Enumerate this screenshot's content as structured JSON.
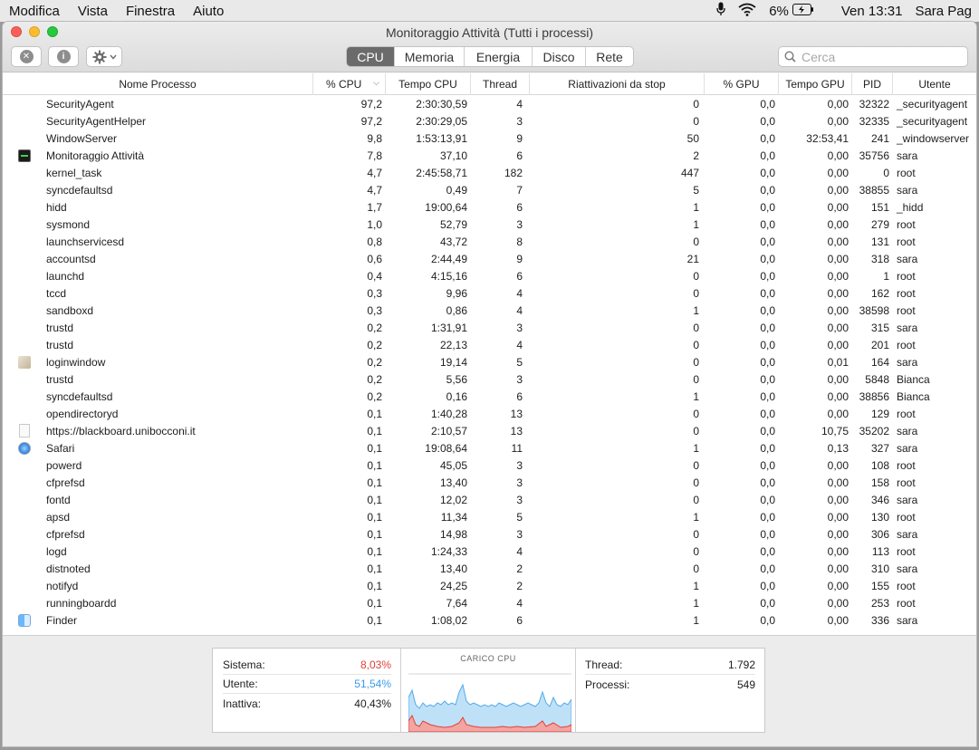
{
  "menubar": {
    "items": [
      "Modifica",
      "Vista",
      "Finestra",
      "Aiuto"
    ],
    "battery": "6%",
    "clock": "Ven 13:31",
    "user": "Sara Pag"
  },
  "window": {
    "title": "Monitoraggio Attività (Tutti i processi)",
    "tabs": [
      {
        "label": "CPU",
        "active": true
      },
      {
        "label": "Memoria",
        "active": false
      },
      {
        "label": "Energia",
        "active": false
      },
      {
        "label": "Disco",
        "active": false
      },
      {
        "label": "Rete",
        "active": false
      }
    ],
    "search_placeholder": "Cerca"
  },
  "table": {
    "columns": [
      "Nome Processo",
      "% CPU",
      "Tempo CPU",
      "Thread",
      "Riattivazioni da stop",
      "% GPU",
      "Tempo GPU",
      "PID",
      "Utente"
    ],
    "rows": [
      {
        "icon": "",
        "name": "SecurityAgent",
        "cpu": "97,2",
        "time": "2:30:30,59",
        "threads": "4",
        "wakeups": "0",
        "gpu": "0,0",
        "gtime": "0,00",
        "pid": "32322",
        "user": "_securityagent"
      },
      {
        "icon": "",
        "name": "SecurityAgentHelper",
        "cpu": "97,2",
        "time": "2:30:29,05",
        "threads": "3",
        "wakeups": "0",
        "gpu": "0,0",
        "gtime": "0,00",
        "pid": "32335",
        "user": "_securityagent"
      },
      {
        "icon": "",
        "name": "WindowServer",
        "cpu": "9,8",
        "time": "1:53:13,91",
        "threads": "9",
        "wakeups": "50",
        "gpu": "0,0",
        "gtime": "32:53,41",
        "pid": "241",
        "user": "_windowserver"
      },
      {
        "icon": "activity-monitor-icon",
        "name": "Monitoraggio Attività",
        "cpu": "7,8",
        "time": "37,10",
        "threads": "6",
        "wakeups": "2",
        "gpu": "0,0",
        "gtime": "0,00",
        "pid": "35756",
        "user": "sara"
      },
      {
        "icon": "",
        "name": "kernel_task",
        "cpu": "4,7",
        "time": "2:45:58,71",
        "threads": "182",
        "wakeups": "447",
        "gpu": "0,0",
        "gtime": "0,00",
        "pid": "0",
        "user": "root"
      },
      {
        "icon": "",
        "name": "syncdefaultsd",
        "cpu": "4,7",
        "time": "0,49",
        "threads": "7",
        "wakeups": "5",
        "gpu": "0,0",
        "gtime": "0,00",
        "pid": "38855",
        "user": "sara"
      },
      {
        "icon": "",
        "name": "hidd",
        "cpu": "1,7",
        "time": "19:00,64",
        "threads": "6",
        "wakeups": "1",
        "gpu": "0,0",
        "gtime": "0,00",
        "pid": "151",
        "user": "_hidd"
      },
      {
        "icon": "",
        "name": "sysmond",
        "cpu": "1,0",
        "time": "52,79",
        "threads": "3",
        "wakeups": "1",
        "gpu": "0,0",
        "gtime": "0,00",
        "pid": "279",
        "user": "root"
      },
      {
        "icon": "",
        "name": "launchservicesd",
        "cpu": "0,8",
        "time": "43,72",
        "threads": "8",
        "wakeups": "0",
        "gpu": "0,0",
        "gtime": "0,00",
        "pid": "131",
        "user": "root"
      },
      {
        "icon": "",
        "name": "accountsd",
        "cpu": "0,6",
        "time": "2:44,49",
        "threads": "9",
        "wakeups": "21",
        "gpu": "0,0",
        "gtime": "0,00",
        "pid": "318",
        "user": "sara"
      },
      {
        "icon": "",
        "name": "launchd",
        "cpu": "0,4",
        "time": "4:15,16",
        "threads": "6",
        "wakeups": "0",
        "gpu": "0,0",
        "gtime": "0,00",
        "pid": "1",
        "user": "root"
      },
      {
        "icon": "",
        "name": "tccd",
        "cpu": "0,3",
        "time": "9,96",
        "threads": "4",
        "wakeups": "0",
        "gpu": "0,0",
        "gtime": "0,00",
        "pid": "162",
        "user": "root"
      },
      {
        "icon": "",
        "name": "sandboxd",
        "cpu": "0,3",
        "time": "0,86",
        "threads": "4",
        "wakeups": "1",
        "gpu": "0,0",
        "gtime": "0,00",
        "pid": "38598",
        "user": "root"
      },
      {
        "icon": "",
        "name": "trustd",
        "cpu": "0,2",
        "time": "1:31,91",
        "threads": "3",
        "wakeups": "0",
        "gpu": "0,0",
        "gtime": "0,00",
        "pid": "315",
        "user": "sara"
      },
      {
        "icon": "",
        "name": "trustd",
        "cpu": "0,2",
        "time": "22,13",
        "threads": "4",
        "wakeups": "0",
        "gpu": "0,0",
        "gtime": "0,00",
        "pid": "201",
        "user": "root"
      },
      {
        "icon": "loginwindow-icon",
        "name": "loginwindow",
        "cpu": "0,2",
        "time": "19,14",
        "threads": "5",
        "wakeups": "0",
        "gpu": "0,0",
        "gtime": "0,01",
        "pid": "164",
        "user": "sara"
      },
      {
        "icon": "",
        "name": "trustd",
        "cpu": "0,2",
        "time": "5,56",
        "threads": "3",
        "wakeups": "0",
        "gpu": "0,0",
        "gtime": "0,00",
        "pid": "5848",
        "user": "Bianca"
      },
      {
        "icon": "",
        "name": "syncdefaultsd",
        "cpu": "0,2",
        "time": "0,16",
        "threads": "6",
        "wakeups": "1",
        "gpu": "0,0",
        "gtime": "0,00",
        "pid": "38856",
        "user": "Bianca"
      },
      {
        "icon": "",
        "name": "opendirectoryd",
        "cpu": "0,1",
        "time": "1:40,28",
        "threads": "13",
        "wakeups": "0",
        "gpu": "0,0",
        "gtime": "0,00",
        "pid": "129",
        "user": "root"
      },
      {
        "icon": "document-icon",
        "name": "https://blackboard.unibocconi.it",
        "cpu": "0,1",
        "time": "2:10,57",
        "threads": "13",
        "wakeups": "0",
        "gpu": "0,0",
        "gtime": "10,75",
        "pid": "35202",
        "user": "sara"
      },
      {
        "icon": "safari-icon",
        "name": "Safari",
        "cpu": "0,1",
        "time": "19:08,64",
        "threads": "11",
        "wakeups": "1",
        "gpu": "0,0",
        "gtime": "0,13",
        "pid": "327",
        "user": "sara"
      },
      {
        "icon": "",
        "name": "powerd",
        "cpu": "0,1",
        "time": "45,05",
        "threads": "3",
        "wakeups": "0",
        "gpu": "0,0",
        "gtime": "0,00",
        "pid": "108",
        "user": "root"
      },
      {
        "icon": "",
        "name": "cfprefsd",
        "cpu": "0,1",
        "time": "13,40",
        "threads": "3",
        "wakeups": "0",
        "gpu": "0,0",
        "gtime": "0,00",
        "pid": "158",
        "user": "root"
      },
      {
        "icon": "",
        "name": "fontd",
        "cpu": "0,1",
        "time": "12,02",
        "threads": "3",
        "wakeups": "0",
        "gpu": "0,0",
        "gtime": "0,00",
        "pid": "346",
        "user": "sara"
      },
      {
        "icon": "",
        "name": "apsd",
        "cpu": "0,1",
        "time": "11,34",
        "threads": "5",
        "wakeups": "1",
        "gpu": "0,0",
        "gtime": "0,00",
        "pid": "130",
        "user": "root"
      },
      {
        "icon": "",
        "name": "cfprefsd",
        "cpu": "0,1",
        "time": "14,98",
        "threads": "3",
        "wakeups": "0",
        "gpu": "0,0",
        "gtime": "0,00",
        "pid": "306",
        "user": "sara"
      },
      {
        "icon": "",
        "name": "logd",
        "cpu": "0,1",
        "time": "1:24,33",
        "threads": "4",
        "wakeups": "0",
        "gpu": "0,0",
        "gtime": "0,00",
        "pid": "113",
        "user": "root"
      },
      {
        "icon": "",
        "name": "distnoted",
        "cpu": "0,1",
        "time": "13,40",
        "threads": "2",
        "wakeups": "0",
        "gpu": "0,0",
        "gtime": "0,00",
        "pid": "310",
        "user": "sara"
      },
      {
        "icon": "",
        "name": "notifyd",
        "cpu": "0,1",
        "time": "24,25",
        "threads": "2",
        "wakeups": "1",
        "gpu": "0,0",
        "gtime": "0,00",
        "pid": "155",
        "user": "root"
      },
      {
        "icon": "",
        "name": "runningboardd",
        "cpu": "0,1",
        "time": "7,64",
        "threads": "4",
        "wakeups": "1",
        "gpu": "0,0",
        "gtime": "0,00",
        "pid": "253",
        "user": "root"
      },
      {
        "icon": "finder-icon",
        "name": "Finder",
        "cpu": "0,1",
        "time": "1:08,02",
        "threads": "6",
        "wakeups": "1",
        "gpu": "0,0",
        "gtime": "0,00",
        "pid": "336",
        "user": "sara"
      }
    ]
  },
  "stats": {
    "sistema_label": "Sistema:",
    "sistema_value": "8,03%",
    "utente_label": "Utente:",
    "utente_value": "51,54%",
    "inattiva_label": "Inattiva:",
    "inattiva_value": "40,43%",
    "chart_title": "CARICO CPU",
    "thread_label": "Thread:",
    "thread_value": "1.792",
    "processi_label": "Processi:",
    "processi_value": "549",
    "colors": {
      "system": "#e0403a",
      "user": "#3c9be8"
    }
  }
}
